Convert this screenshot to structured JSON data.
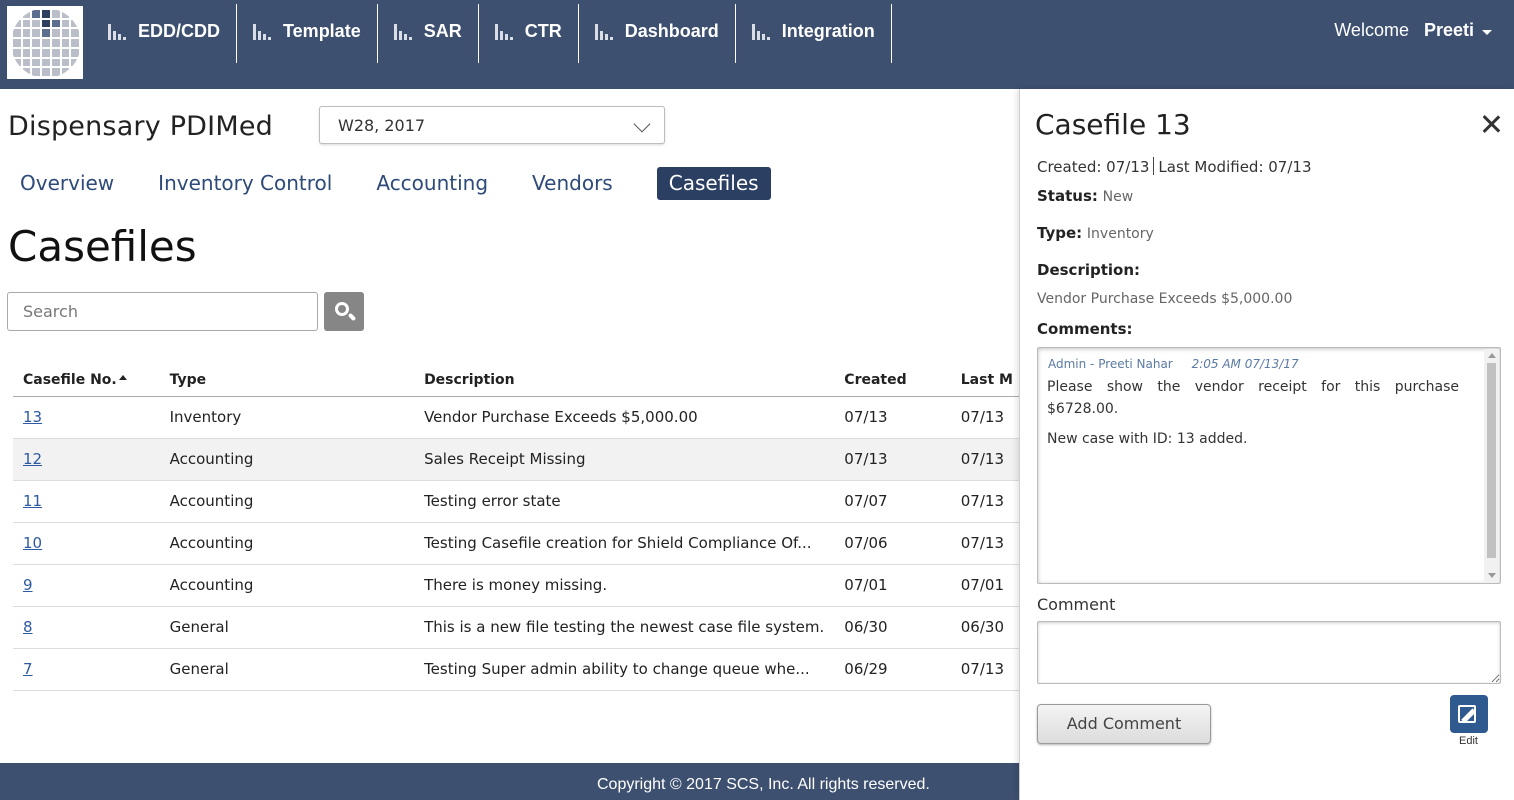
{
  "nav": {
    "items": [
      {
        "label": "EDD/CDD",
        "icon": "bar-chart-icon"
      },
      {
        "label": "Template",
        "icon": "bar-chart-icon"
      },
      {
        "label": "SAR",
        "icon": "bar-chart-icon"
      },
      {
        "label": "CTR",
        "icon": "bar-chart-icon"
      },
      {
        "label": "Dashboard",
        "icon": "bar-chart-icon"
      },
      {
        "label": "Integration",
        "icon": "bar-chart-icon"
      }
    ],
    "welcome": "Welcome",
    "user_name": "Preeti"
  },
  "main": {
    "client_name": "Dispensary PDIMed",
    "week_selected": "W28, 2017",
    "tabs": [
      {
        "label": "Overview",
        "active": false
      },
      {
        "label": "Inventory Control",
        "active": false
      },
      {
        "label": "Accounting",
        "active": false
      },
      {
        "label": "Vendors",
        "active": false
      },
      {
        "label": "Casefiles",
        "active": true
      }
    ],
    "page_title": "Casefiles",
    "search_placeholder": "Search"
  },
  "table": {
    "columns": [
      "Casefile No.",
      "Type",
      "Description",
      "Created",
      "Last M"
    ],
    "rows": [
      {
        "no": "13",
        "type": "Inventory",
        "description": "Vendor Purchase Exceeds $5,000.00",
        "created": "07/13",
        "last": "07/13"
      },
      {
        "no": "12",
        "type": "Accounting",
        "description": "Sales Receipt Missing",
        "created": "07/13",
        "last": "07/13"
      },
      {
        "no": "11",
        "type": "Accounting",
        "description": "Testing error state",
        "created": "07/07",
        "last": "07/13"
      },
      {
        "no": "10",
        "type": "Accounting",
        "description": "Testing Casefile creation for Shield Compliance Of...",
        "created": "07/06",
        "last": "07/13"
      },
      {
        "no": "9",
        "type": "Accounting",
        "description": "There is money missing.",
        "created": "07/01",
        "last": "07/01"
      },
      {
        "no": "8",
        "type": "General",
        "description": "This is a new file testing the newest case file system.",
        "created": "06/30",
        "last": "06/30"
      },
      {
        "no": "7",
        "type": "General",
        "description": "Testing Super admin ability to change queue whe...",
        "created": "06/29",
        "last": "07/13"
      }
    ]
  },
  "footer": {
    "copyright": "Copyright © 2017 SCS, Inc. All rights reserved."
  },
  "panel": {
    "title": "Casefile 13",
    "created": "Created: 07/13",
    "modified": "Last Modified: 07/13",
    "status_label": "Status:",
    "status_value": "New",
    "type_label": "Type:",
    "type_value": "Inventory",
    "description_label": "Description:",
    "description_value": "Vendor Purchase Exceeds $5,000.00",
    "comments_label": "Comments:",
    "comment_author": "Admin - Preeti Nahar",
    "comment_time": "2:05 AM 07/13/17",
    "comment_text": "Please show the vendor receipt for this purchase $6728.00.",
    "comment_text_2": "New case with ID: 13 added.",
    "comment_field_label": "Comment",
    "add_button": "Add Comment",
    "edit_label": "Edit"
  }
}
